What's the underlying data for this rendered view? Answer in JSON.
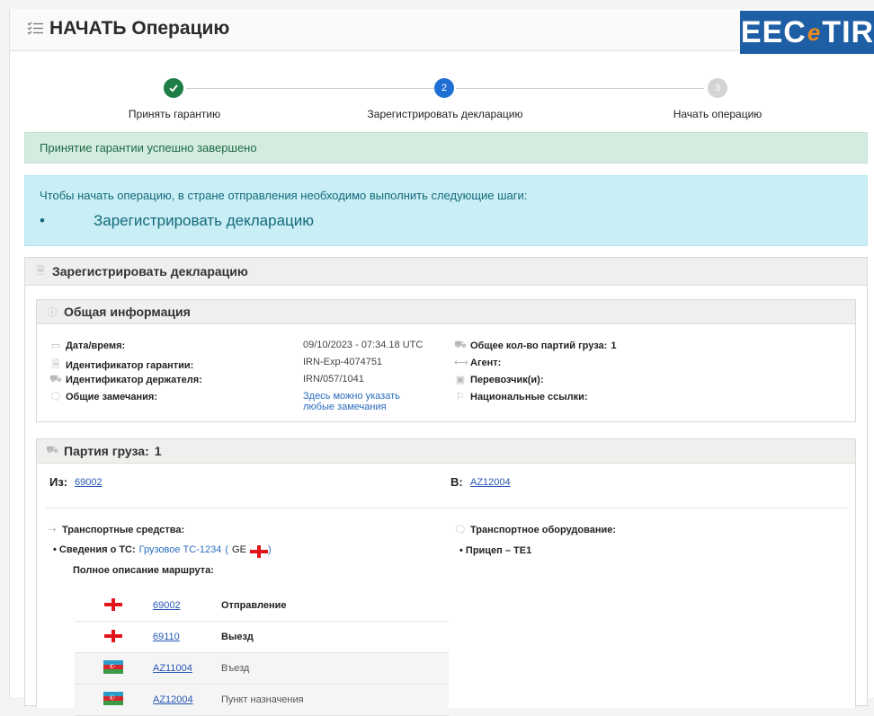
{
  "header": {
    "title": "НАЧАТЬ Операцию",
    "logo": {
      "pre": "EEC",
      "e": "e",
      "post": "TIR"
    }
  },
  "stepper": {
    "steps": [
      {
        "label": "Принять гарантию",
        "state": "done",
        "num": "1"
      },
      {
        "label": "Зарегистрировать декларацию",
        "state": "active",
        "num": "2"
      },
      {
        "label": "Начать операцию",
        "state": "pending",
        "num": "3"
      }
    ]
  },
  "alerts": {
    "success": "Принятие гарантии успешно завершено",
    "info_text": "Чтобы начать операцию, в стране отправления необходимо выполнить следующие шаги:",
    "info_bullet": "•",
    "info_item": "Зарегистрировать декларацию"
  },
  "panel": {
    "title": "Зарегистрировать декларацию"
  },
  "general": {
    "title": "Общая информация",
    "datetime_label": "Дата/время:",
    "datetime_value": "09/10/2023 - 07:34.18 UTC",
    "guarantee_label": "Идентификатор гарантии:",
    "guarantee_value": "IRN-Exp-4074751",
    "holder_label": "Идентификатор держателя:",
    "holder_value": "IRN/057/1041",
    "remarks_label": "Общие замечания:",
    "remarks_value_1": "Здесь можно указать",
    "remarks_value_2": "любые замечания",
    "consignments_label": "Общее кол-во партий груза:",
    "consignments_value": "1",
    "agent_label": "Агент:",
    "carrier_label": "Перевозчик(и):",
    "national_label": "Национальные ссылки:"
  },
  "consignment": {
    "title": "Партия груза:",
    "number": "1",
    "from_label": "Из:",
    "from_value": "69002",
    "to_label": "В:",
    "to_value": "AZ12004",
    "vehicles_label": "Транспортные средства:",
    "vehicle_info_label": "• Сведения о ТС:",
    "vehicle_info_value": "Грузовое ТС-1234",
    "vehicle_country_open": "(",
    "vehicle_country": "GE",
    "vehicle_country_close": ")",
    "route_label": "Полное описание маршрута:",
    "equipment_label": "Транспортное оборудование:",
    "equipment_item": "•   Прицеп – TE1",
    "route": [
      {
        "flag": "GE",
        "code": "69002",
        "label": "Отправление"
      },
      {
        "flag": "GE",
        "code": "69110",
        "label": "Выезд"
      },
      {
        "flag": "AZ",
        "code": "AZ11004",
        "label": "Въезд"
      },
      {
        "flag": "AZ",
        "code": "AZ12004",
        "label": "Пункт назначения"
      }
    ]
  },
  "colors": {
    "done": "#1e7e45",
    "active": "#1f6fd4",
    "pending": "#d4d4d4",
    "brand": "#1d5ea4"
  }
}
